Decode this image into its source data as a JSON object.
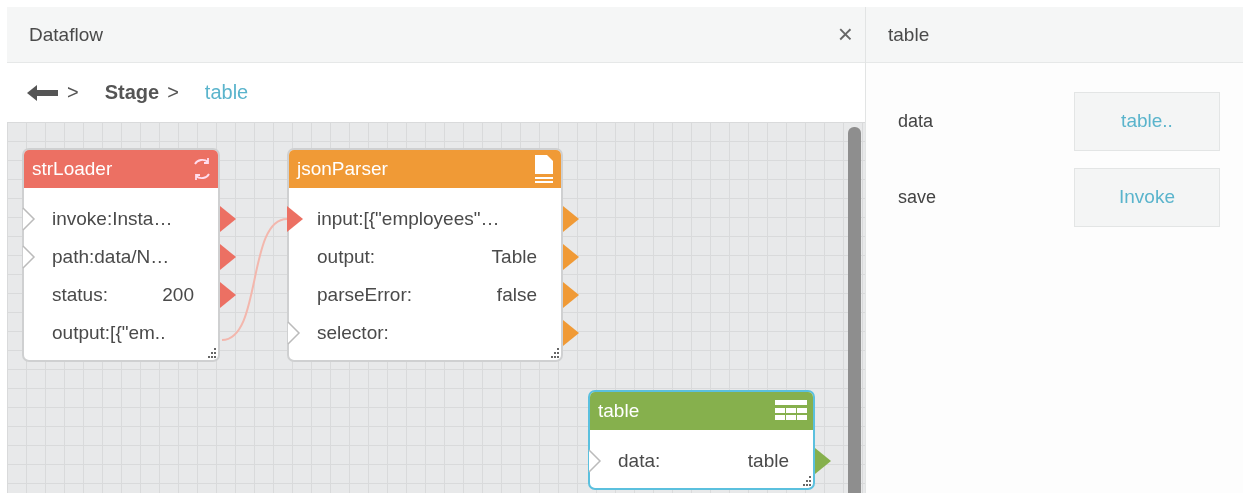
{
  "dataflow_panel": {
    "title": "Dataflow",
    "close": "×"
  },
  "breadcrumb": [
    {
      "label": "Stage",
      "selected": false
    },
    {
      "label": "table",
      "selected": true
    }
  ],
  "breadcrumb_separator": ">",
  "nodes": [
    {
      "title": "strLoader",
      "kind": "loader",
      "color": "#ec7063",
      "selected": false,
      "ports": [
        {
          "label": "invoke:Insta…",
          "input": true,
          "connected": false,
          "output": true
        },
        {
          "label": "path:data/N…",
          "input": true,
          "connected": false,
          "output": true
        },
        {
          "label": "status:",
          "value": "200",
          "input": false,
          "connected": false,
          "output": true
        },
        {
          "label": "output:[{\"em..",
          "input": false,
          "connected": false,
          "output": false
        }
      ]
    },
    {
      "title": "jsonParser",
      "kind": "parser",
      "color": "#f09a36",
      "selected": false,
      "ports": [
        {
          "label": "input:[{\"employees\"…",
          "input": true,
          "connected": true,
          "output": true
        },
        {
          "label": "output:",
          "value": "Table",
          "input": false,
          "connected": false,
          "output": true
        },
        {
          "label": "parseError:",
          "value": "false",
          "input": false,
          "connected": false,
          "output": true
        },
        {
          "label": "selector:",
          "input": true,
          "connected": false,
          "output": true
        }
      ]
    },
    {
      "title": "table",
      "kind": "table",
      "color": "#86b04d",
      "selected": true,
      "ports": [
        {
          "label": "data:",
          "value": "table",
          "input": true,
          "connected": false,
          "output": true
        }
      ]
    }
  ],
  "inspector": {
    "title": "table",
    "properties": [
      {
        "label": "data",
        "button": "table.."
      },
      {
        "label": "save",
        "button": "Invoke"
      }
    ]
  }
}
